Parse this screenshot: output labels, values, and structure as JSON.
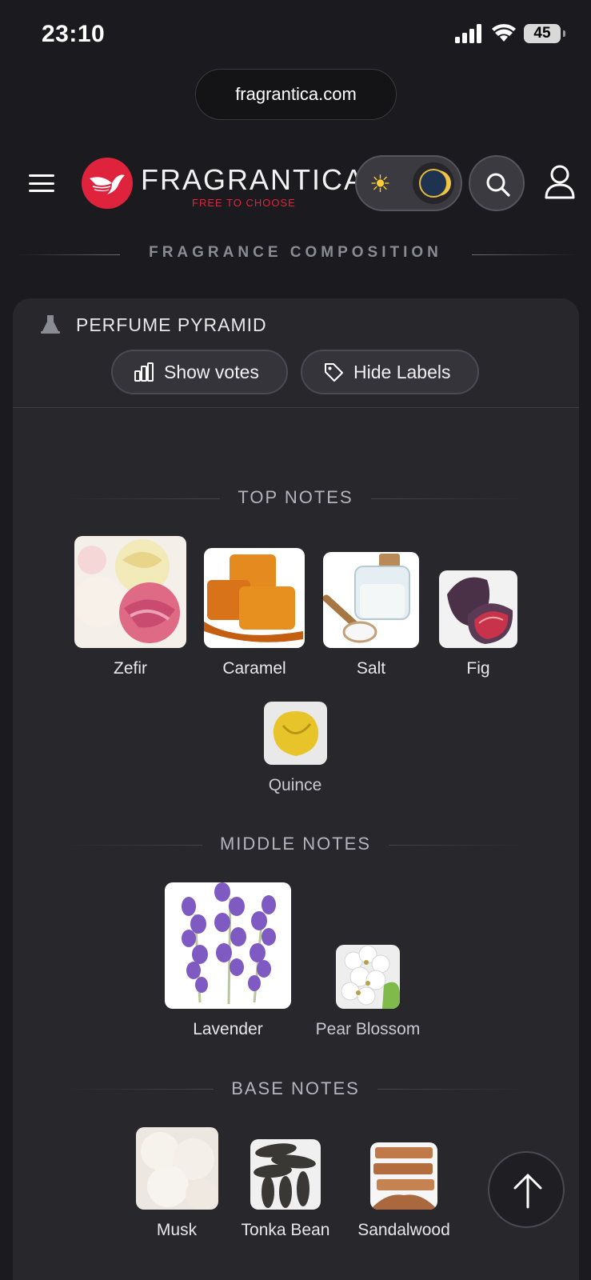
{
  "status_bar": {
    "time": "23:10",
    "battery": "45",
    "signal_icon": "cellular-signal-icon",
    "wifi_icon": "wifi-icon"
  },
  "browser": {
    "url": "fragrantica.com"
  },
  "header": {
    "brand": "FRAGRANTICA",
    "tagline": "FREE TO CHOOSE",
    "brand_color": "#e0233d",
    "menu_icon": "hamburger-menu-icon",
    "sun_icon": "sun-icon",
    "moon_icon": "moon-icon",
    "search_icon": "search-icon",
    "user_icon": "user-icon"
  },
  "section_title": "FRAGRANCE COMPOSITION",
  "pyramid": {
    "title": "PERFUME PYRAMID",
    "show_votes_label": "Show votes",
    "hide_labels_label": "Hide Labels",
    "top_notes": {
      "heading": "TOP NOTES",
      "items": [
        {
          "name": "Zefir"
        },
        {
          "name": "Caramel"
        },
        {
          "name": "Salt"
        },
        {
          "name": "Fig"
        },
        {
          "name": "Quince"
        }
      ]
    },
    "middle_notes": {
      "heading": "MIDDLE NOTES",
      "items": [
        {
          "name": "Lavender"
        },
        {
          "name": "Pear Blossom"
        }
      ]
    },
    "base_notes": {
      "heading": "BASE NOTES",
      "items": [
        {
          "name": "Musk"
        },
        {
          "name": "Tonka Bean"
        },
        {
          "name": "Sandalwood"
        }
      ]
    }
  },
  "scroll_top_icon": "arrow-up-icon"
}
